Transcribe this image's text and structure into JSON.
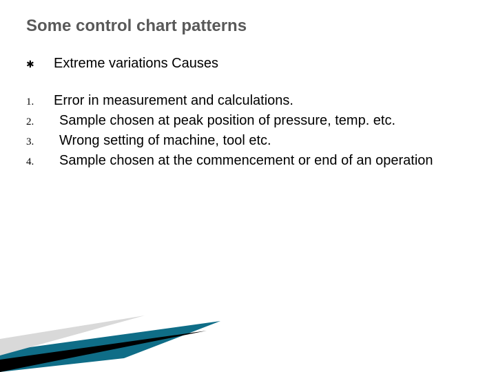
{
  "title": "Some control chart patterns",
  "heading": "Extreme variations Causes",
  "items": [
    {
      "n": "1.",
      "text": "Error in measurement and calculations."
    },
    {
      "n": "2.",
      "text": "Sample chosen at peak position of pressure, temp. etc."
    },
    {
      "n": "3.",
      "text": "Wrong setting of machine, tool etc."
    },
    {
      "n": "4.",
      "text": "Sample chosen at the commencement or end of an operation"
    }
  ]
}
